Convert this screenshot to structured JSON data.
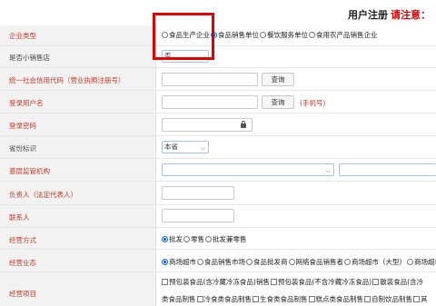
{
  "header": {
    "title": "用户注册",
    "note": "请注意："
  },
  "fields": {
    "enterprise_type": {
      "label": "企业类型",
      "options": [
        "食品生产企业",
        "食品销售单位",
        "餐饮服务单位",
        "食用农产品销售企业"
      ]
    },
    "is_small_shop": {
      "label": "是否小销售店",
      "value": "否"
    },
    "credit_code": {
      "label": "统一社会信用代码（营业执照注册号）",
      "button": "查询"
    },
    "username": {
      "label": "登录用户名",
      "button": "查询",
      "hint": "(手机号)"
    },
    "password": {
      "label": "登录密码"
    },
    "province": {
      "label": "省份标识",
      "value": "本省"
    },
    "authority": {
      "label": "基层监管机构"
    },
    "legal_person": {
      "label": "负责人（法定代表人）"
    },
    "contact": {
      "label": "联系人"
    },
    "business_mode": {
      "label": "经营方式",
      "options": [
        "批发",
        "零售",
        "批发兼零售"
      ]
    },
    "business_format": {
      "label": "经营业态",
      "options": [
        "商场超市",
        "食品销售市场",
        "食品批发商",
        "网络食品销售者",
        "商场超市（大型）",
        "商场超市"
      ]
    },
    "business_items": {
      "label": "经营项目",
      "line1": [
        "预包装食品(含冷藏冷冻食品)销售",
        "预包装食品(不含冷藏冷冻食品)",
        "散装食品(含冷"
      ],
      "line2": [
        "类食品制售",
        "冷食类食品制售",
        "生食类食品制售",
        "糕点类食品制售",
        "自制饮品制售",
        "其"
      ]
    }
  },
  "colors": {
    "accent": "#1a64c8",
    "required_label": "#c0392b",
    "highlight": "#e00000",
    "label_bg": "#f2f2f2"
  },
  "icons": {
    "select_chevron": "chevron-down-icon",
    "password": "lock-icon"
  }
}
